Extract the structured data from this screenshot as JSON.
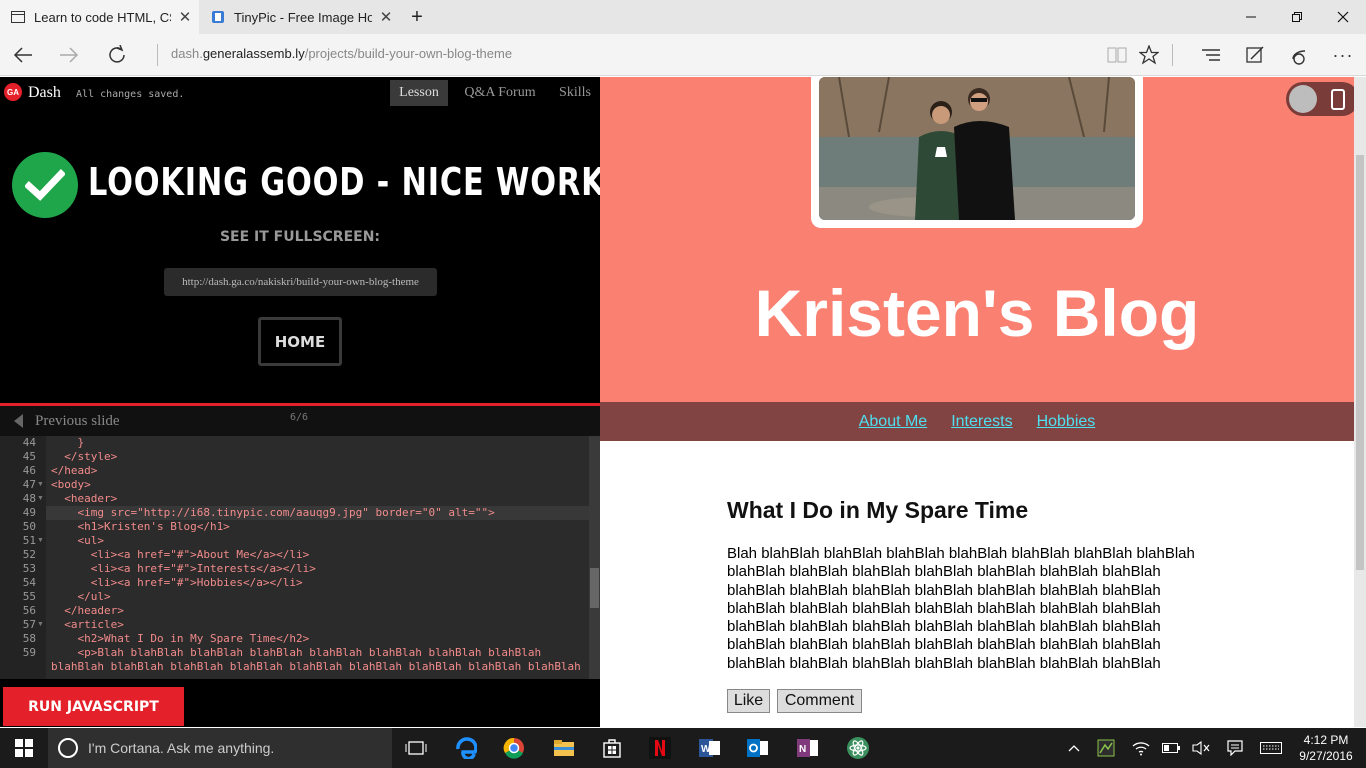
{
  "browser": {
    "tabs": [
      {
        "label": "Learn to code HTML, CS",
        "active": true
      },
      {
        "label": "TinyPic - Free Image Hostin",
        "active": false
      }
    ],
    "new_tab_symbol": "+",
    "address": {
      "prefix": "dash.",
      "domain": "generalassemb.ly",
      "path": "/projects/build-your-own-blog-theme"
    }
  },
  "dash": {
    "logo_text": "GA",
    "title": "Dash",
    "status": "All changes saved.",
    "tabs": [
      "Lesson",
      "Q&A Forum",
      "Skills"
    ],
    "active_tab": "Lesson",
    "success_title": "LOOKING GOOD - NICE WORK!",
    "fullscreen_label": "SEE IT FULLSCREEN:",
    "fullscreen_url": "http://dash.ga.co/nakiskri/build-your-own-blog-theme",
    "home_label": "HOME",
    "previous_label": "Previous slide",
    "slide_counter": "6/6",
    "run_label": "RUN JAVASCRIPT"
  },
  "code": {
    "line_numbers": [
      "44",
      "45",
      "46",
      "47",
      "48",
      "49",
      "50",
      "51",
      "52",
      "53",
      "54",
      "55",
      "56",
      "57",
      "58",
      "59"
    ],
    "lines": [
      "    }",
      "  </style>",
      "</head>",
      "<body>",
      "  <header>",
      "    <img src=\"http://i68.tinypic.com/aauqg9.jpg\" border=\"0\" alt=\"\">",
      "    <h1>Kristen's Blog</h1>",
      "    <ul>",
      "      <li><a href=\"#\">About Me</a></li>",
      "      <li><a href=\"#\">Interests</a></li>",
      "      <li><a href=\"#\">Hobbies</a></li>",
      "    </ul>",
      "  </header>",
      "  <article>",
      "    <h2>What I Do in My Spare Time</h2>",
      "    <p>Blah blahBlah blahBlah blahBlah blahBlah blahBlah blahBlah blahBlah"
    ],
    "wrap_line": "blahBlah blahBlah blahBlah blahBlah blahBlah blahBlah blahBlah blahBlah blahBlah"
  },
  "preview": {
    "blog_title": "Kristen's Blog",
    "nav": [
      "About Me",
      "Interests",
      "Hobbies"
    ],
    "article_title": "What I Do in My Spare Time",
    "article_lines": [
      "Blah blahBlah blahBlah blahBlah blahBlah blahBlah blahBlah blahBlah",
      "blahBlah blahBlah blahBlah blahBlah blahBlah blahBlah blahBlah",
      "blahBlah blahBlah blahBlah blahBlah blahBlah blahBlah blahBlah",
      "blahBlah blahBlah blahBlah blahBlah blahBlah blahBlah blahBlah",
      "blahBlah blahBlah blahBlah blahBlah blahBlah blahBlah blahBlah",
      "blahBlah blahBlah blahBlah blahBlah blahBlah blahBlah blahBlah",
      "blahBlah blahBlah blahBlah blahBlah blahBlah blahBlah blahBlah"
    ],
    "like_label": "Like",
    "comment_label": "Comment",
    "colors": {
      "header": "#fa8072",
      "nav": "#824343",
      "links": "#4ee0f0"
    }
  },
  "taskbar": {
    "cortana_placeholder": "I'm Cortana. Ask me anything.",
    "apps": [
      "task-view-icon",
      "edge-icon",
      "chrome-icon",
      "file-explorer-icon",
      "store-icon",
      "netflix-icon",
      "word-icon",
      "outlook-icon",
      "onenote-icon",
      "atom-icon"
    ],
    "time": "4:12 PM",
    "date": "9/27/2016"
  }
}
